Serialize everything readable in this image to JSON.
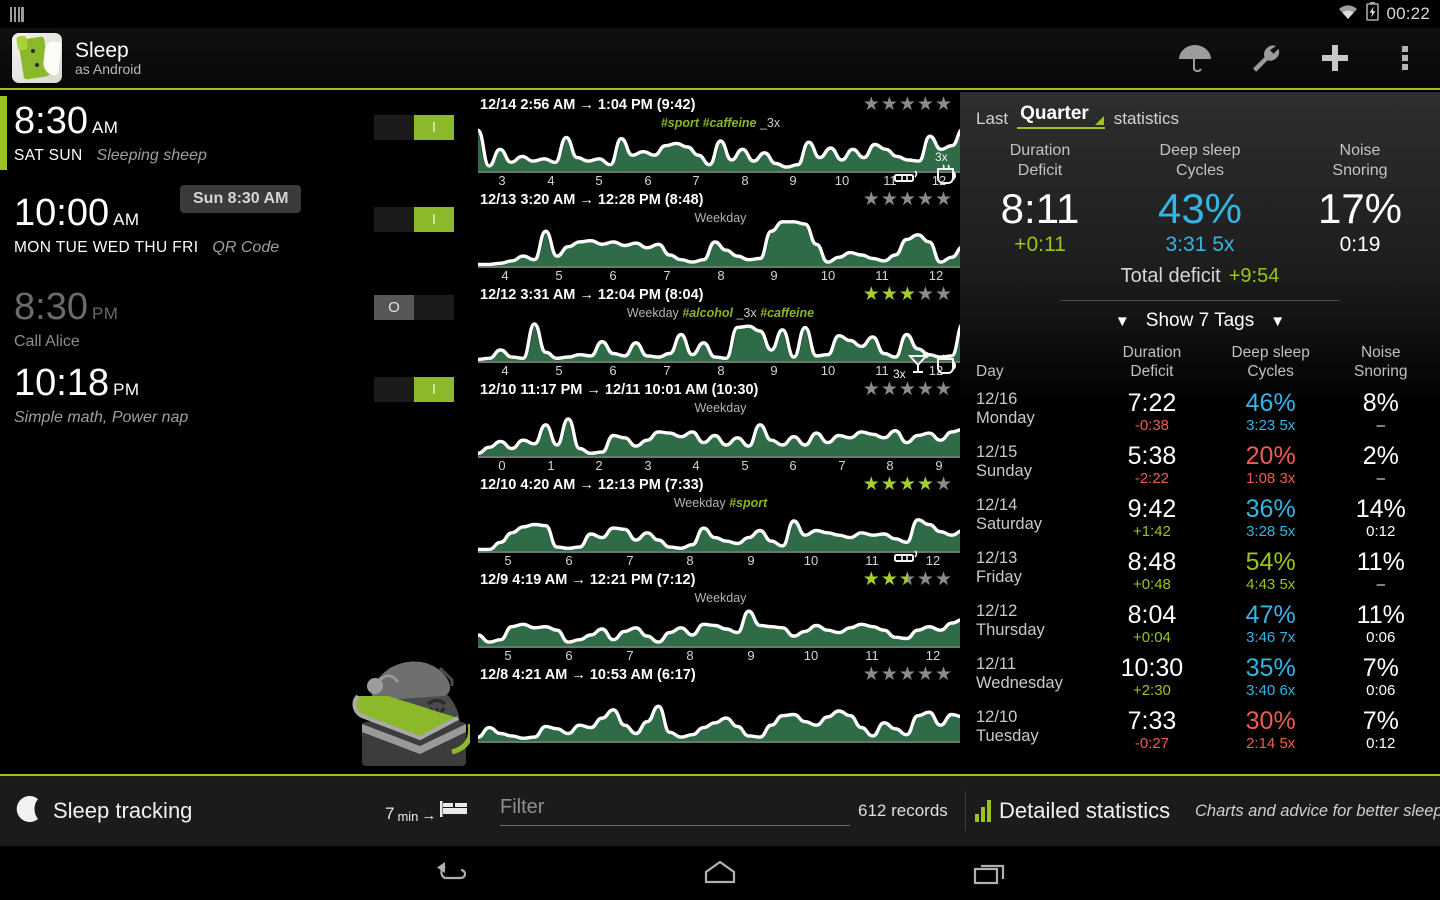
{
  "statusbar": {
    "clock": "00:22",
    "icons": [
      "sim-icon",
      "wifi-icon",
      "battery-charging-icon"
    ]
  },
  "actionbar": {
    "title": "Sleep",
    "subtitle": "as Android",
    "actions": [
      {
        "name": "umbrella-icon",
        "label": "Umbrella"
      },
      {
        "name": "wrench-icon",
        "label": "Wrench"
      },
      {
        "name": "plus-icon",
        "label": "Add alarm"
      },
      {
        "name": "overflow-menu-icon",
        "label": "More options"
      }
    ]
  },
  "tooltip": "Sun 8:30 AM",
  "alarms": [
    {
      "time": "8:30",
      "ampm": "AM",
      "days": "SAT SUN",
      "label": "Sleeping sheep",
      "enabled": true,
      "selected": true,
      "toggle_on": "I",
      "toggle_off": "O"
    },
    {
      "time": "10:00",
      "ampm": "AM",
      "days": "MON TUE WED THU FRI",
      "label": "QR Code",
      "enabled": true,
      "selected": false,
      "toggle_on": "I",
      "toggle_off": "O"
    },
    {
      "time": "8:30",
      "ampm": "PM",
      "days": "",
      "label": "Call Alice",
      "enabled": false,
      "selected": false,
      "toggle_on": "I",
      "toggle_off": "O"
    },
    {
      "time": "10:18",
      "ampm": "PM",
      "days": "",
      "label": "Simple math, Power nap",
      "enabled": true,
      "selected": false,
      "toggle_on": "I",
      "toggle_off": "O"
    }
  ],
  "chart_data": {
    "type": "area",
    "title": "Sleep records actigraph graphs",
    "ylabel": "Actigraph movement",
    "xlabel": "Hour of day",
    "records": [
      {
        "title": "12/14 2:56 AM → 1:04 PM (9:42)",
        "date": "12/14",
        "start": "2:56 AM",
        "end": "1:04 PM",
        "duration": "9:42",
        "rating": 0,
        "tags": [
          {
            "text": "#sport",
            "type": "hash"
          },
          {
            "text": "#caffeine",
            "type": "hash"
          },
          {
            "text": "_3x",
            "type": "mult"
          }
        ],
        "ticks": [
          "3",
          "4",
          "5",
          "6",
          "7",
          "8",
          "9",
          "10",
          "11",
          "12"
        ],
        "icons": [
          "cigarette-icon",
          "coffee-icon"
        ],
        "icon_labels": [
          "",
          "3x"
        ],
        "values": [
          72,
          12,
          40,
          18,
          28,
          20,
          24,
          18,
          60,
          26,
          20,
          24,
          14,
          58,
          30,
          36,
          30,
          46,
          50,
          44,
          30,
          14,
          54,
          22,
          40,
          20,
          34,
          16,
          10,
          14,
          52,
          26,
          42,
          22,
          40,
          26,
          48,
          40,
          28,
          22,
          20,
          62,
          40,
          46,
          74
        ]
      },
      {
        "title": "12/13 3:20 AM → 12:28 PM (8:48)",
        "date": "12/13",
        "start": "3:20 AM",
        "end": "12:28 PM",
        "duration": "8:48",
        "rating": 0,
        "tags": [
          {
            "text": "Weekday",
            "type": "weekday"
          }
        ],
        "ticks": [
          "4",
          "5",
          "6",
          "7",
          "8",
          "9",
          "10",
          "11",
          "12"
        ],
        "icons": [],
        "values": [
          6,
          6,
          8,
          12,
          20,
          14,
          62,
          20,
          36,
          44,
          46,
          40,
          44,
          38,
          42,
          34,
          40,
          22,
          14,
          10,
          14,
          44,
          30,
          20,
          14,
          16,
          62,
          78,
          78,
          74,
          40,
          10,
          18,
          26,
          22,
          16,
          12,
          22,
          48,
          56,
          44,
          10,
          18,
          36
        ]
      },
      {
        "title": "12/12 3:31 AM → 12:04 PM (8:04)",
        "date": "12/12",
        "start": "3:31 AM",
        "end": "12:04 PM",
        "duration": "8:04",
        "rating": 3,
        "tags": [
          {
            "text": "Weekday",
            "type": "weekday"
          },
          {
            "text": "#alcohol",
            "type": "hash"
          },
          {
            "text": "_3x",
            "type": "mult"
          },
          {
            "text": "#caffeine",
            "type": "hash"
          }
        ],
        "ticks": [
          "4",
          "5",
          "6",
          "7",
          "8",
          "9",
          "10",
          "11",
          "12"
        ],
        "icons": [
          "cocktail-icon",
          "coffee-icon"
        ],
        "icon_labels": [
          "3x",
          ""
        ],
        "values": [
          6,
          8,
          22,
          10,
          8,
          66,
          18,
          8,
          10,
          14,
          12,
          36,
          16,
          12,
          34,
          12,
          10,
          16,
          48,
          14,
          34,
          10,
          8,
          60,
          62,
          54,
          22,
          56,
          10,
          60,
          12,
          14,
          46,
          38,
          28,
          44,
          16,
          10,
          48,
          24,
          14,
          10,
          12,
          66
        ]
      },
      {
        "title": "12/10 11:17 PM → 12/11 10:01 AM (10:30)",
        "date": "12/10",
        "start": "11:17 PM",
        "end": "12/11 10:01 AM",
        "duration": "10:30",
        "rating": 0,
        "tags": [
          {
            "text": "Weekday",
            "type": "weekday"
          }
        ],
        "ticks": [
          "0",
          "1",
          "2",
          "3",
          "4",
          "5",
          "6",
          "7",
          "8",
          "9"
        ],
        "icons": [],
        "values": [
          8,
          18,
          28,
          16,
          30,
          24,
          56,
          22,
          66,
          16,
          8,
          10,
          38,
          34,
          20,
          30,
          44,
          42,
          36,
          44,
          26,
          38,
          22,
          34,
          20,
          56,
          30,
          22,
          36,
          22,
          42,
          26,
          38,
          34,
          44,
          40,
          34,
          46,
          26,
          38,
          42,
          30,
          44,
          48
        ]
      },
      {
        "title": "12/10 4:20 AM → 12:13 PM (7:33)",
        "date": "12/10",
        "start": "4:20 AM",
        "end": "12:13 PM",
        "duration": "7:33",
        "rating": 4,
        "tags": [
          {
            "text": "Weekday",
            "type": "weekday"
          },
          {
            "text": "#sport",
            "type": "hash"
          }
        ],
        "ticks": [
          "5",
          "6",
          "7",
          "8",
          "9",
          "10",
          "11",
          "12"
        ],
        "icons": [
          "cigarette-icon"
        ],
        "icon_labels": [
          ""
        ],
        "values": [
          6,
          6,
          18,
          34,
          44,
          48,
          46,
          10,
          8,
          10,
          32,
          26,
          42,
          40,
          22,
          34,
          22,
          10,
          8,
          14,
          42,
          26,
          20,
          16,
          26,
          38,
          20,
          12,
          54,
          30,
          38,
          34,
          30,
          26,
          34,
          30,
          32,
          24,
          18,
          56,
          48,
          36,
          30,
          38
        ]
      },
      {
        "title": "12/9 4:19 AM → 12:21 PM (7:12)",
        "date": "12/9",
        "start": "4:19 AM",
        "end": "12:21 PM",
        "duration": "7:12",
        "rating": 2.5,
        "tags": [
          {
            "text": "Weekday",
            "type": "weekday"
          }
        ],
        "ticks": [
          "5",
          "6",
          "7",
          "8",
          "9",
          "10",
          "11",
          "12"
        ],
        "icons": [],
        "values": [
          22,
          10,
          14,
          36,
          40,
          34,
          36,
          30,
          10,
          14,
          22,
          32,
          14,
          28,
          34,
          20,
          10,
          26,
          34,
          22,
          40,
          38,
          32,
          26,
          62,
          38,
          36,
          34,
          20,
          28,
          38,
          30,
          26,
          34,
          40,
          36,
          30,
          18,
          16,
          30,
          36,
          30,
          42,
          48
        ]
      },
      {
        "title": "12/8 4:21 AM → 10:53 AM (6:17)",
        "date": "12/8",
        "start": "4:21 AM",
        "end": "10:53 AM",
        "duration": "6:17",
        "rating": 0,
        "tags": [],
        "ticks": [],
        "icons": [],
        "values": [
          10,
          26,
          16,
          12,
          8,
          10,
          28,
          24,
          16,
          30,
          26,
          42,
          56,
          30,
          16,
          36,
          62,
          18,
          10,
          14,
          26,
          34,
          42,
          28,
          12,
          10,
          30,
          46,
          48,
          36,
          30,
          44,
          54,
          46,
          26,
          12,
          34,
          24,
          14,
          46,
          52,
          30,
          48,
          44
        ]
      }
    ]
  },
  "stats": {
    "header": {
      "last": "Last",
      "period": "Quarter",
      "statistics": "statistics"
    },
    "summary": [
      {
        "caption_1": "Duration",
        "caption_2": "Deficit",
        "big": "8:11",
        "big_color": "white",
        "sub": "+0:11",
        "sub_color": "green"
      },
      {
        "caption_1": "Deep sleep",
        "caption_2": "Cycles",
        "big": "43%",
        "big_color": "blue",
        "sub": "3:31 5x",
        "sub_color": "blue"
      },
      {
        "caption_1": "Noise",
        "caption_2": "Snoring",
        "big": "17%",
        "big_color": "white",
        "sub": "0:19",
        "sub_color": "white"
      }
    ],
    "total_deficit_label": "Total deficit",
    "total_deficit_value": "+9:54",
    "show_tags": "Show 7 Tags",
    "table_headers": {
      "day": "Day",
      "c1a": "Duration",
      "c1b": "Deficit",
      "c2a": "Deep sleep",
      "c2b": "Cycles",
      "c3a": "Noise",
      "c3b": "Snoring"
    },
    "rows": [
      {
        "date": "12/16",
        "weekday": "Monday",
        "dur": "7:22",
        "dur_color": "white",
        "def": "-0:38",
        "def_color": "red",
        "deep": "46%",
        "deep_color": "blue",
        "cyc": "3:23 5x",
        "cyc_color": "blue",
        "noise": "8%",
        "snor": "–",
        "noise_color": "white"
      },
      {
        "date": "12/15",
        "weekday": "Sunday",
        "dur": "5:38",
        "dur_color": "white",
        "def": "-2:22",
        "def_color": "red",
        "deep": "20%",
        "deep_color": "red",
        "cyc": "1:08 3x",
        "cyc_color": "red",
        "noise": "2%",
        "snor": "–",
        "noise_color": "white"
      },
      {
        "date": "12/14",
        "weekday": "Saturday",
        "dur": "9:42",
        "dur_color": "white",
        "def": "+1:42",
        "def_color": "green",
        "deep": "36%",
        "deep_color": "blue",
        "cyc": "3:28 5x",
        "cyc_color": "blue",
        "noise": "14%",
        "snor": "0:12",
        "noise_color": "white"
      },
      {
        "date": "12/13",
        "weekday": "Friday",
        "dur": "8:48",
        "dur_color": "white",
        "def": "+0:48",
        "def_color": "green",
        "deep": "54%",
        "deep_color": "green",
        "cyc": "4:43 5x",
        "cyc_color": "green",
        "noise": "11%",
        "snor": "–",
        "noise_color": "white"
      },
      {
        "date": "12/12",
        "weekday": "Thursday",
        "dur": "8:04",
        "dur_color": "white",
        "def": "+0:04",
        "def_color": "green",
        "deep": "47%",
        "deep_color": "blue",
        "cyc": "3:46 7x",
        "cyc_color": "blue",
        "noise": "11%",
        "snor": "0:06",
        "noise_color": "white"
      },
      {
        "date": "12/11",
        "weekday": "Wednesday",
        "dur": "10:30",
        "dur_color": "white",
        "def": "+2:30",
        "def_color": "green",
        "deep": "35%",
        "deep_color": "blue",
        "cyc": "3:40 6x",
        "cyc_color": "blue",
        "noise": "7%",
        "snor": "0:06",
        "noise_color": "white"
      },
      {
        "date": "12/10",
        "weekday": "Tuesday",
        "dur": "7:33",
        "dur_color": "white",
        "def": "-0:27",
        "def_color": "red",
        "deep": "30%",
        "deep_color": "red",
        "cyc": "2:14 5x",
        "cyc_color": "red",
        "noise": "7%",
        "snor": "0:12",
        "noise_color": "white"
      }
    ]
  },
  "bottombar": {
    "tracking_label": "Sleep tracking",
    "delay_number": "7",
    "delay_unit": "min",
    "filter_placeholder": "Filter",
    "filter_value": "",
    "records": "612 records",
    "detailed_statistics": "Detailed statistics",
    "advice": "Charts and advice for better sleep"
  },
  "navbar": {
    "back": "back-icon",
    "home": "home-icon",
    "recents": "recents-icon"
  },
  "colors": {
    "accent_green": "#9ac31c",
    "blue": "#33b5e5",
    "red": "#f05a50",
    "chart_fill": "#2f6b46",
    "chart_line": "#ffffff"
  }
}
